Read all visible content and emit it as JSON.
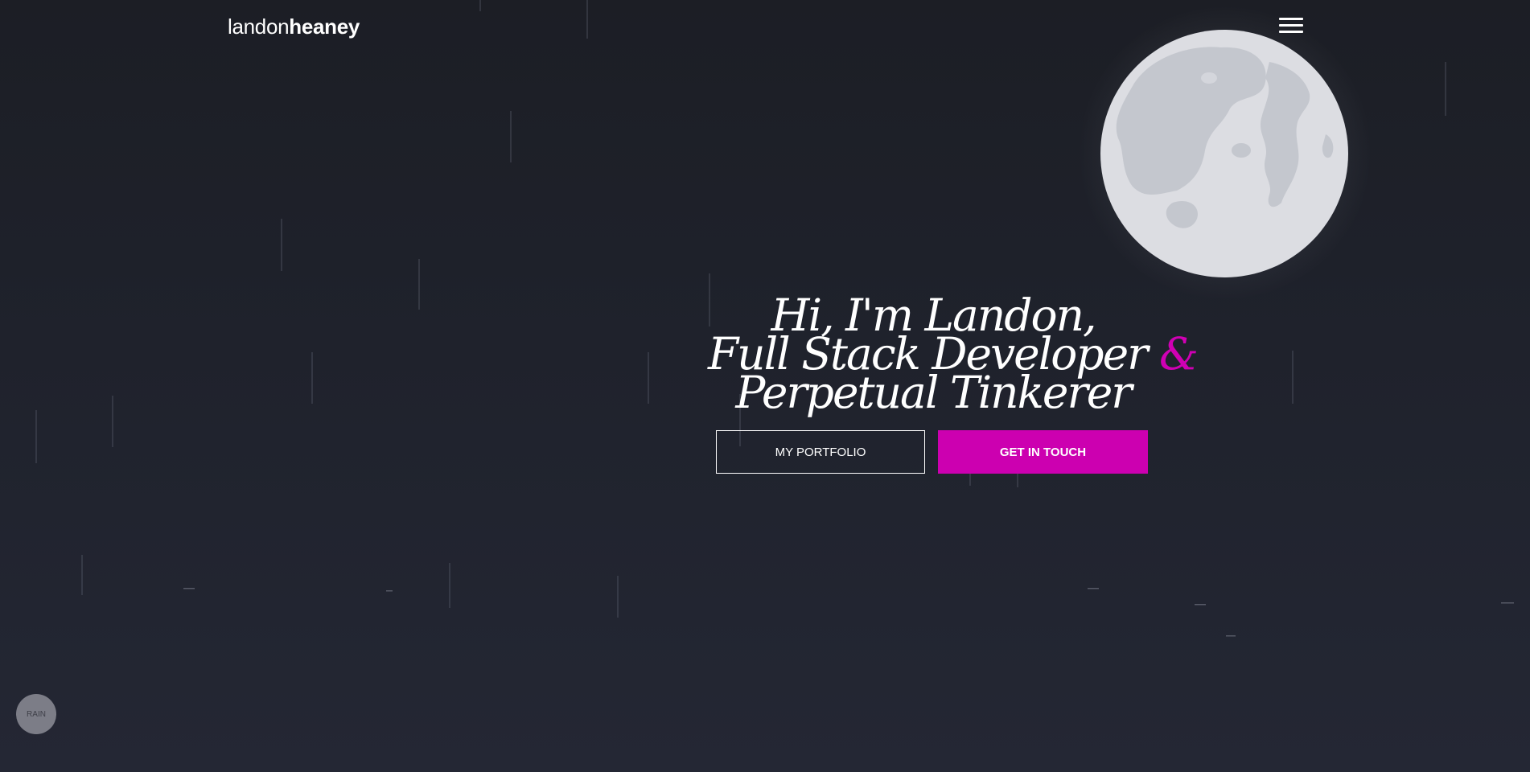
{
  "header": {
    "logo_first": "landon",
    "logo_second": "heaney",
    "menu_icon": "hamburger-menu-icon"
  },
  "hero": {
    "line1": "Hi, I'm Landon,",
    "line2": "Full Stack Developer",
    "ampersand": "&",
    "line3": "Perpetual Tinkerer"
  },
  "buttons": {
    "portfolio_label": "MY PORTFOLIO",
    "contact_label": "GET IN TOUCH"
  },
  "rain_toggle": {
    "label": "RAIN"
  },
  "colors": {
    "accent": "#cc00b0",
    "background_top": "#1c1e25",
    "background_bottom": "#242734",
    "moon": "#dcdde2",
    "moon_craters": "#c4c7ce"
  }
}
